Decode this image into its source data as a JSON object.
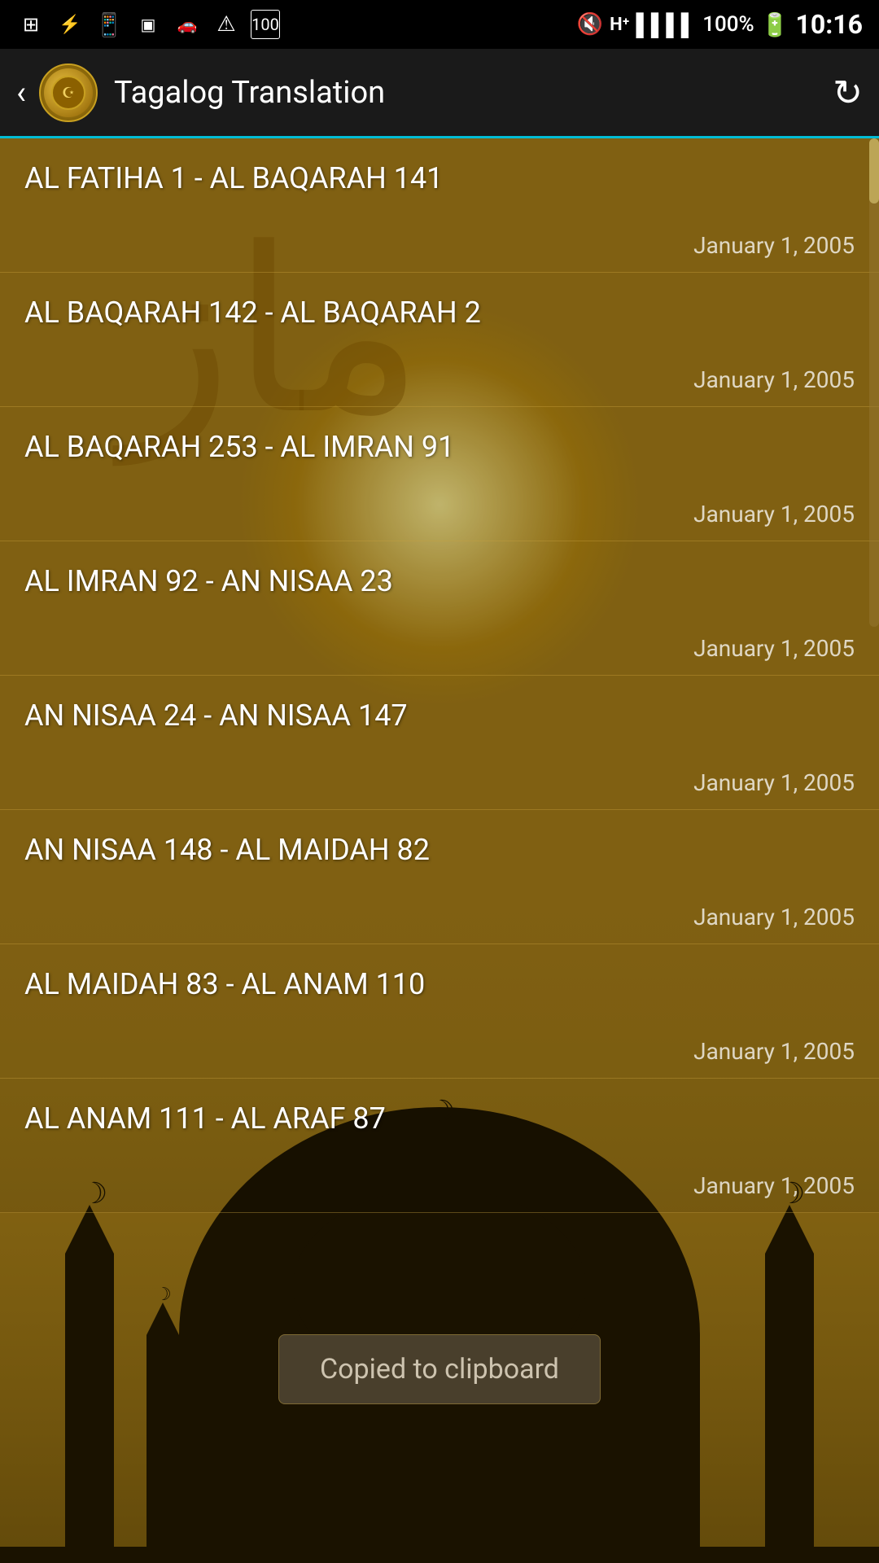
{
  "statusBar": {
    "time": "10:16",
    "battery": "100%",
    "icons": [
      "usb",
      "whatsapp",
      "samsung",
      "car",
      "warning",
      "number-100",
      "silent",
      "signal-h+",
      "signal-bars",
      "battery-full"
    ]
  },
  "appBar": {
    "title": "Tagalog Translation",
    "backLabel": "‹",
    "refreshLabel": "↻"
  },
  "list": {
    "items": [
      {
        "title": "AL FATIHA 1 - AL BAQARAH 141",
        "date": "January 1, 2005"
      },
      {
        "title": "AL BAQARAH 142 - AL BAQARAH 2",
        "date": "January 1, 2005"
      },
      {
        "title": "AL BAQARAH 253 - AL IMRAN 91",
        "date": "January 1, 2005"
      },
      {
        "title": "AL IMRAN 92 - AN NISAA 23",
        "date": "January 1, 2005"
      },
      {
        "title": "AN NISAA 24 - AN NISAA 147",
        "date": "January 1, 2005"
      },
      {
        "title": "AN NISAA 148 - AL MAIDAH 82",
        "date": "January 1, 2005"
      },
      {
        "title": "AL MAIDAH 83 - AL ANAM 110",
        "date": "January 1, 2005"
      },
      {
        "title": "AL ANAM 111 - AL ARAF 87",
        "date": "January 1, 2005"
      }
    ]
  },
  "toast": {
    "message": "Copied to clipboard"
  }
}
